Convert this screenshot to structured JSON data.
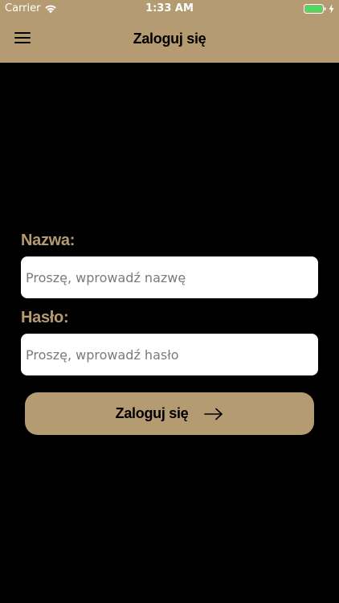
{
  "status_bar": {
    "carrier": "Carrier",
    "time": "1:33 AM",
    "icons": [
      "wifi-icon",
      "battery-icon",
      "charging-icon"
    ],
    "battery_color": "#4cd964"
  },
  "nav": {
    "title": "Zaloguj się",
    "menu_icon": "hamburger-menu-icon"
  },
  "form": {
    "username": {
      "label": "Nazwa:",
      "placeholder": "Proszę, wprowadź nazwę",
      "value": ""
    },
    "password": {
      "label": "Hasło:",
      "placeholder": "Proszę, wprowadź hasło",
      "value": ""
    },
    "submit": {
      "label": "Zaloguj się",
      "icon": "arrow-right-icon"
    }
  },
  "colors": {
    "accent": "#b59b72",
    "background": "#000000",
    "input_background": "#ffffff"
  }
}
